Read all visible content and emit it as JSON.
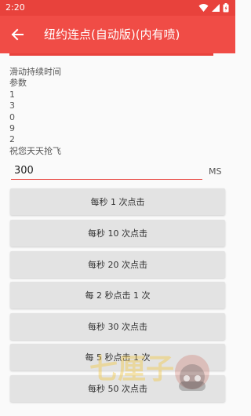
{
  "status": {
    "time": "2:20"
  },
  "appbar": {
    "title": "纽约连点(自动版)(内有喷)"
  },
  "info_lines": [
    "滑动持续时间",
    "参数",
    "1",
    "3",
    "0",
    "9",
    "2",
    "祝您天天抢飞"
  ],
  "input": {
    "value": "300",
    "unit": "MS"
  },
  "buttons": [
    "每秒 1 次点击",
    "每秒 10 次点击",
    "每秒 20 次点击",
    "每 2 秒点击 1 次",
    "每秒 30 次点击",
    "每 5 秒点击 1 次",
    "每秒 50 次点击"
  ],
  "watermark": {
    "text": "七厘子"
  },
  "colors": {
    "accent": "#f04c46",
    "status_bar": "#e8423c",
    "button_bg": "#e3e3e3"
  }
}
